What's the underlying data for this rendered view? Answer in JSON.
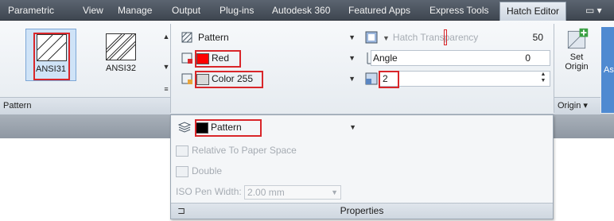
{
  "menu": {
    "tabs": [
      "Parametric",
      "View",
      "Manage",
      "Output",
      "Plug-ins",
      "Autodesk 360",
      "Featured Apps",
      "Express Tools"
    ],
    "active_tab": "Hatch Editor",
    "overflow": "▭ ▾"
  },
  "patterns": {
    "items": [
      {
        "label": "ANSI31",
        "selected": true
      },
      {
        "label": "ANSI32",
        "selected": false
      }
    ],
    "panel_title": "Pattern"
  },
  "properties": {
    "type_value": "Pattern",
    "color_value": "Red",
    "background_value": "Color 255",
    "transparency_label": "Hatch Transparency",
    "transparency_value": "50",
    "angle_label": "Angle",
    "angle_value": "0",
    "scale_value": "2",
    "layer_value": "Pattern",
    "relative_label": "Relative To Paper Space",
    "double_label": "Double",
    "iso_label": "ISO Pen Width:",
    "iso_value": "2.00 mm",
    "panel_title": "Properties",
    "colors": {
      "red": "#ff0000",
      "background": "#d9d9d9",
      "layer": "#000000"
    }
  },
  "origin": {
    "set_label_1": "Set",
    "set_label_2": "Origin",
    "panel_title": "Origin ▾",
    "cut_label": "As"
  }
}
